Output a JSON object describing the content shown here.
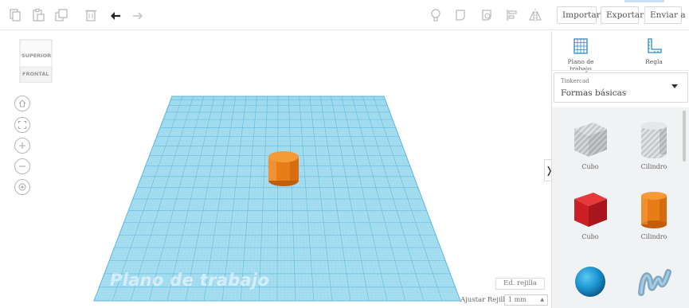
{
  "toolbar": {
    "import_label": "Importar",
    "export_label": "Exportar",
    "send_label": "Enviar a",
    "left_tools": [
      "copy-icon",
      "paste-icon",
      "duplicate-icon",
      "delete-icon",
      "undo-icon",
      "redo-icon"
    ],
    "right_tools": [
      "light-bulb-icon",
      "shape-icon",
      "hole-icon",
      "align-icon",
      "mirror-icon"
    ]
  },
  "viewport": {
    "viewcube": {
      "top_face": "SUPERIOR",
      "front_face": "FRONTAL"
    },
    "nav_buttons": [
      "home-icon",
      "fit-icon",
      "zoom-in-icon",
      "zoom-out-icon",
      "orbit-icon"
    ],
    "workplane_label": "Plano de trabajo",
    "edit_grid_label": "Ed. rejilla",
    "snap_grid_label": "Ajustar Rejilla",
    "snap_grid_value": "1 mm",
    "grid_color": "#8fd0ea",
    "cylinder_color": "#f28a1c"
  },
  "panel": {
    "workplane_tool_label": "Plano de trabajo",
    "ruler_tool_label": "Regla",
    "library_source": "Tinkercad",
    "library_name": "Formas básicas",
    "shapes": [
      {
        "name": "Cubo",
        "style": "hole"
      },
      {
        "name": "Cilindro",
        "style": "hole"
      },
      {
        "name": "Cubo",
        "style": "solid",
        "color": "#cc1f24"
      },
      {
        "name": "Cilindro",
        "style": "solid",
        "color": "#f28a1c"
      }
    ],
    "accent_color": "#2a88c8"
  }
}
